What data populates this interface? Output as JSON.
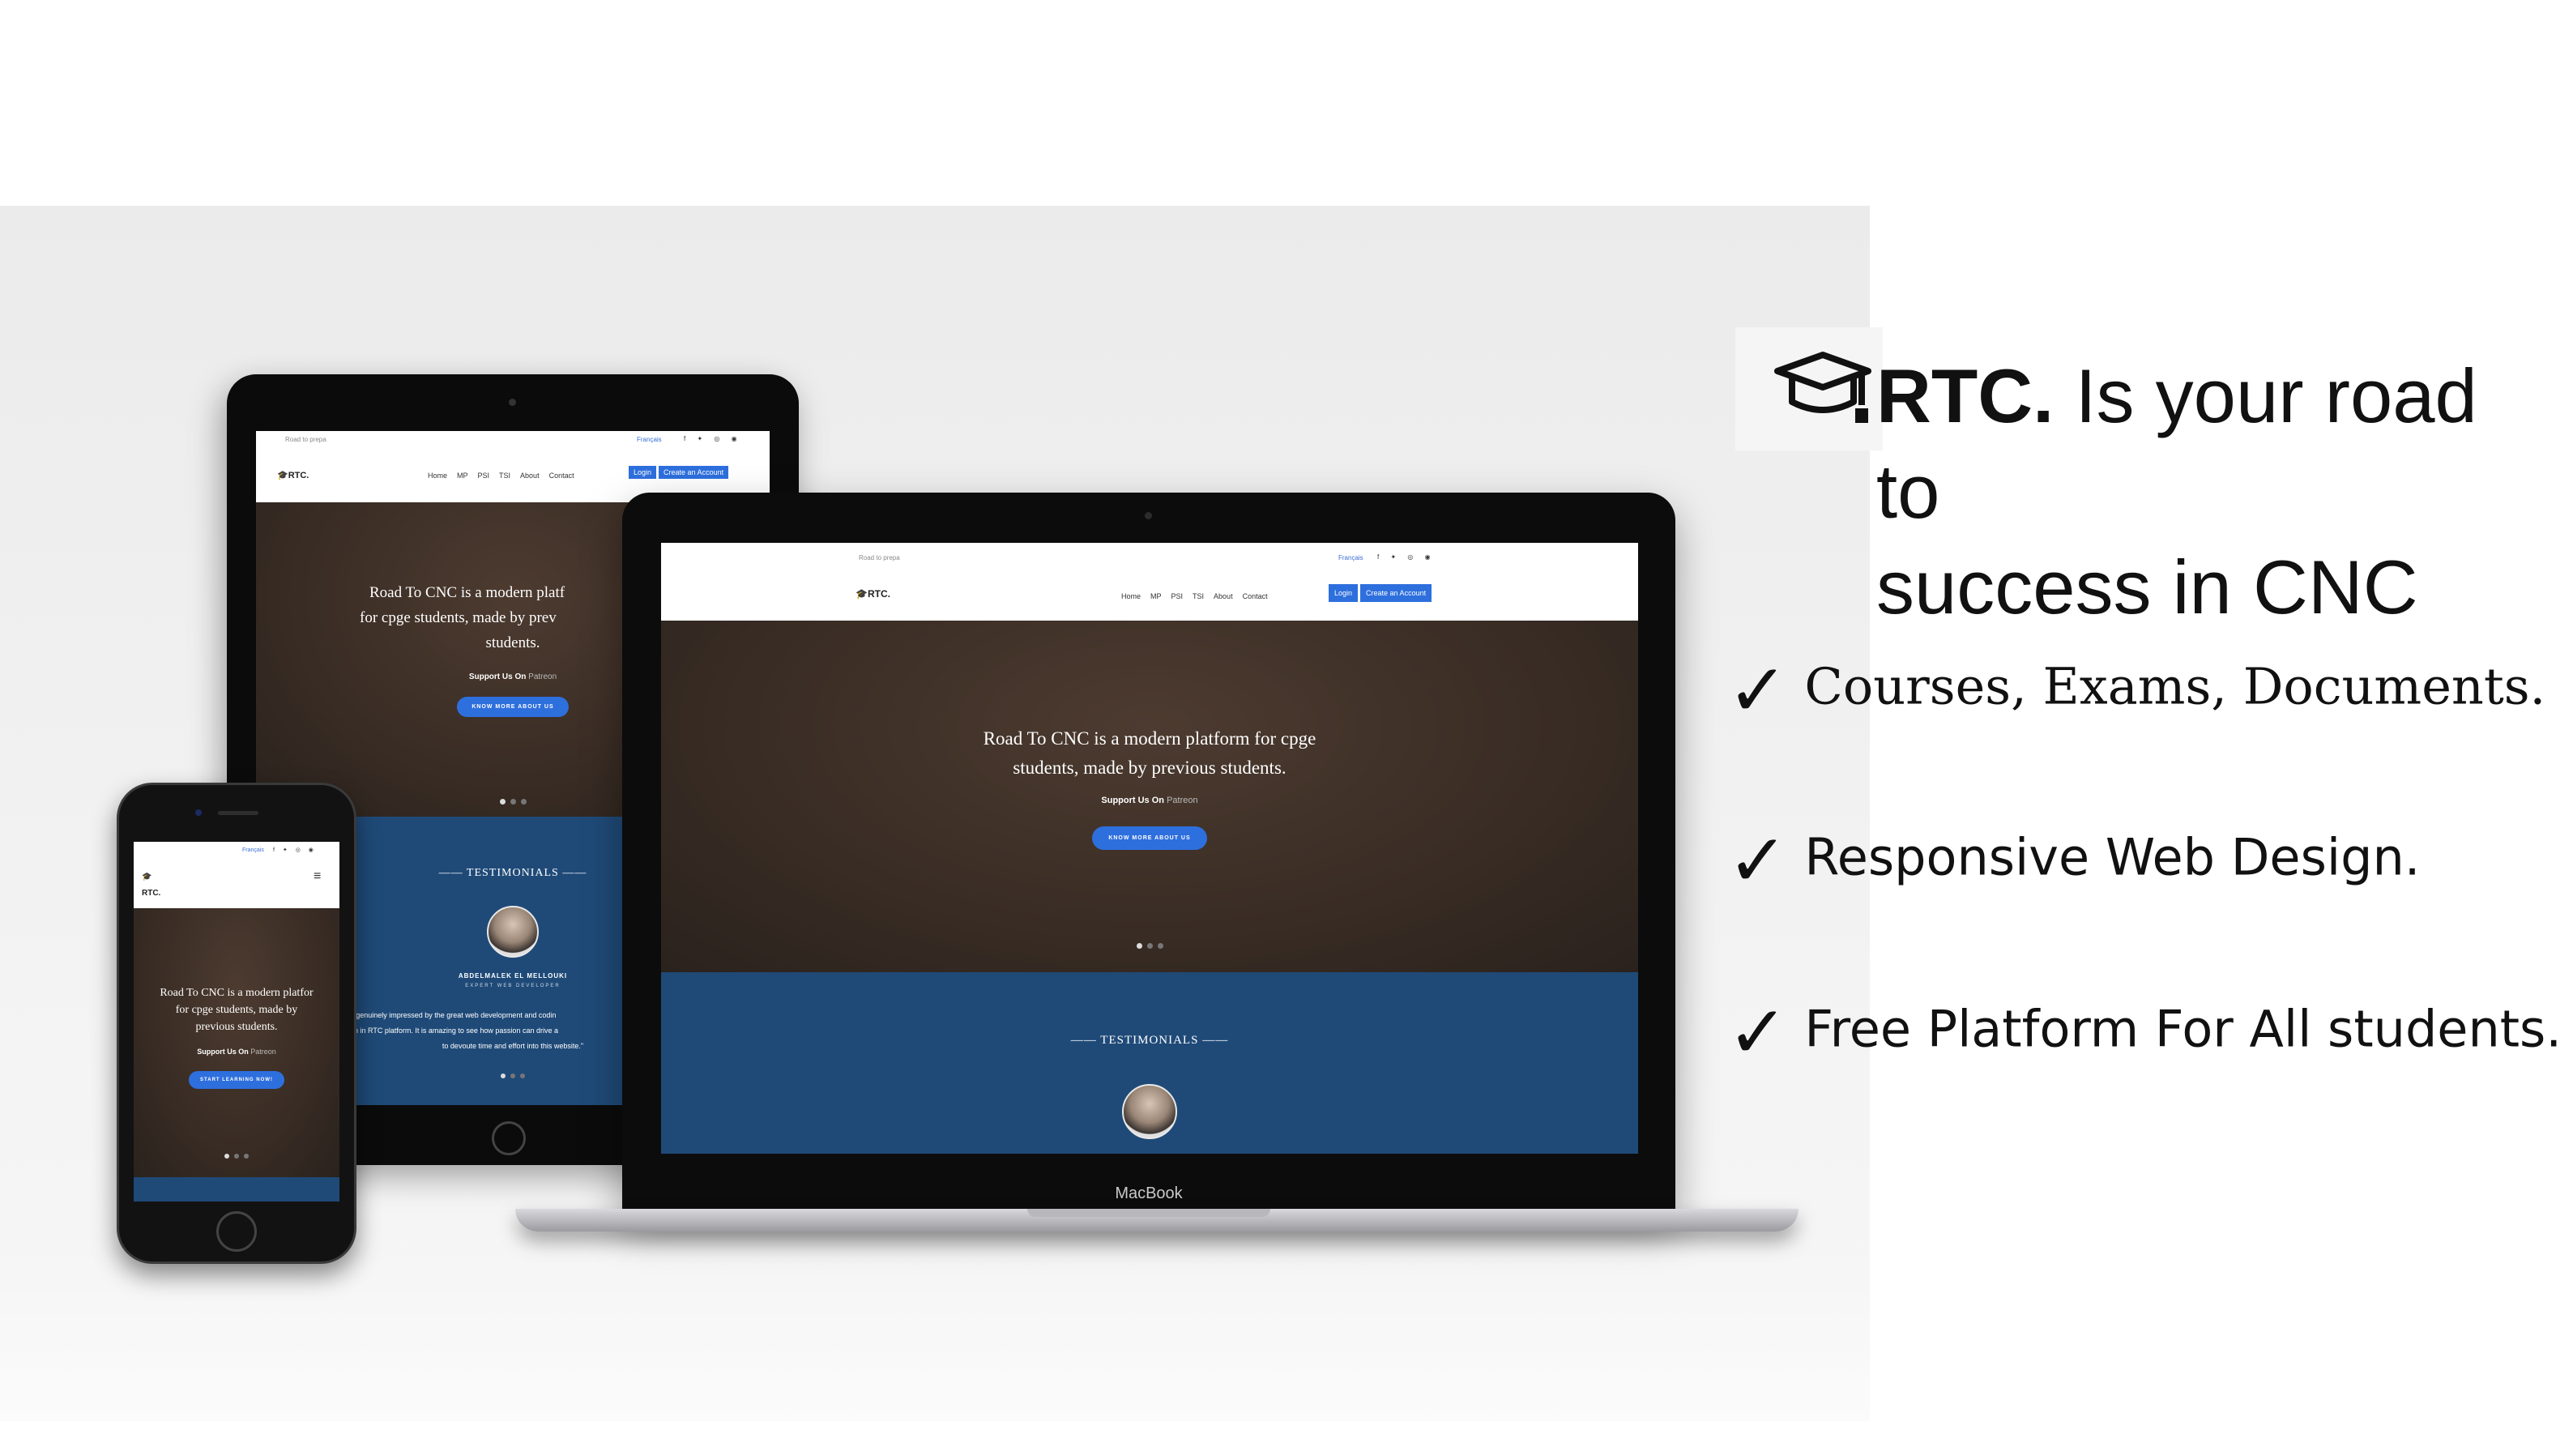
{
  "headline": {
    "brand": "RTC.",
    "line1_rest": "Is your road to",
    "line2": "success in CNC"
  },
  "features": [
    {
      "check": "✓",
      "text": "Courses, Exams, Documents."
    },
    {
      "check": "✓",
      "text": "Responsive Web Design."
    },
    {
      "check": "✓",
      "text": "Free Platform For All students."
    }
  ],
  "site": {
    "topbar_left": "Road to prepa",
    "lang": "Français",
    "logo": "RTC.",
    "nav": [
      "Home",
      "MP",
      "PSI",
      "TSI",
      "About",
      "Contact"
    ],
    "login": "Login",
    "create_account": "Create an Account",
    "hero_title": "Road To CNC is a modern platform for cpge students, made by previous students.",
    "hero_title_tablet_l1": "Road To CNC is a modern platf",
    "hero_title_tablet_l2": "for cpge students, made by prev",
    "hero_title_tablet_l3": "students.",
    "hero_title_phone_l1": "Road To CNC is a modern platfor",
    "hero_title_phone_l2": "for cpge students, made by",
    "hero_title_phone_l3": "previous students.",
    "support_prefix": "Support Us On",
    "support_link": "Patreon",
    "cta_know_more": "KNOW MORE ABOUT US",
    "cta_start": "START LEARNING NOW!",
    "testimonials": "TESTIMONIALS",
    "testimonial_name": "ABDELMALEK EL MELLOUKI",
    "testimonial_role": "EXPERT WEB DEVELOPER",
    "testimonial_quote_l1": "\"I am genuinely impressed by the great web development and codin",
    "testimonial_quote_l2": "shown in RTC platform. It is amazing to see how passion can drive a",
    "testimonial_quote_l3": "to devoute time and effort into this website.\""
  },
  "laptop_brand": "MacBook",
  "colors": {
    "accent": "#2e6fde",
    "hero_bg": "#3a2d25",
    "testimonials_bg": "#1f4a78"
  }
}
